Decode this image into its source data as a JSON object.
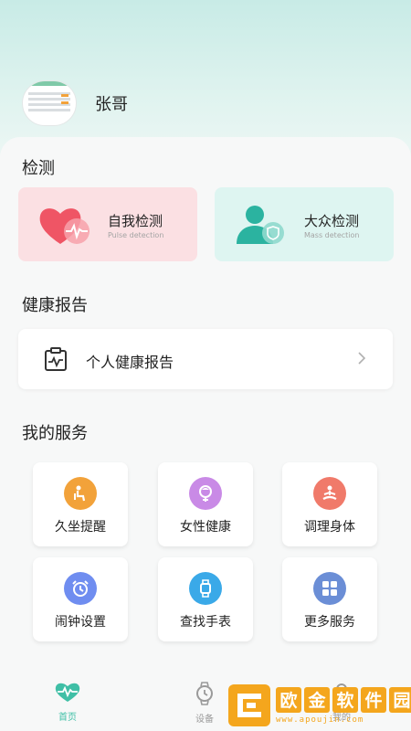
{
  "profile": {
    "name": "张哥"
  },
  "sections": {
    "detection": "检测",
    "health_report": "健康报告",
    "my_services": "我的服务"
  },
  "detection_cards": [
    {
      "label": "自我检测",
      "sub": "Pulse detection",
      "icon": "heart-pulse-icon",
      "bg": "#fbe0e3"
    },
    {
      "label": "大众检测",
      "sub": "Mass detection",
      "icon": "person-shield-icon",
      "bg": "#def5f1"
    }
  ],
  "report": {
    "label": "个人健康报告",
    "icon": "clipboard-pulse-icon"
  },
  "services": [
    {
      "label": "久坐提醒",
      "icon": "sitting-person-icon",
      "color": "#f2a23a"
    },
    {
      "label": "女性健康",
      "icon": "female-icon",
      "color": "#c98ae6"
    },
    {
      "label": "调理身体",
      "icon": "meditation-icon",
      "color": "#f07a6a"
    },
    {
      "label": "闹钟设置",
      "icon": "alarm-clock-icon",
      "color": "#6f8df0"
    },
    {
      "label": "查找手表",
      "icon": "watch-icon",
      "color": "#3aa9e8"
    },
    {
      "label": "更多服务",
      "icon": "grid-icon",
      "color": "#6b8ed6"
    }
  ],
  "tabbar": {
    "home": "首页",
    "device": "设备",
    "mine": "我的"
  },
  "watermark": {
    "text": "欧金软件园",
    "url": "www.apoujin.com"
  },
  "colors": {
    "accent": "#3fbfa6"
  }
}
